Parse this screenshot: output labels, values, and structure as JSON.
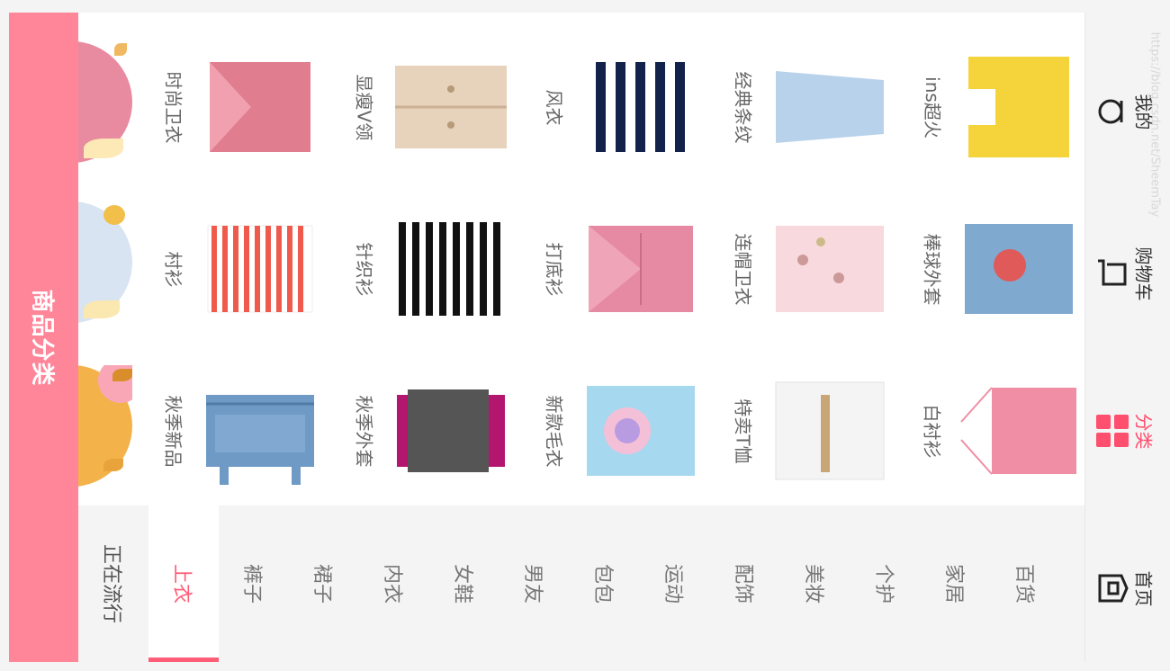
{
  "header": {
    "title": "商品分类"
  },
  "products": [
    {
      "label": "秋季新品",
      "icon": "denim-coat-icon"
    },
    {
      "label": "村衫",
      "icon": "striped-top-icon"
    },
    {
      "label": "时尚卫衣",
      "icon": "pink-sweater-icon"
    },
    {
      "label": "秋季外套",
      "icon": "vest-over-shirt-icon"
    },
    {
      "label": "针织衫",
      "icon": "striped-knit-icon"
    },
    {
      "label": "显瘦V领",
      "icon": "trench-coat-icon"
    },
    {
      "label": "新款毛衣",
      "icon": "tshirt-icon"
    },
    {
      "label": "打底衫",
      "icon": "pink-hoodie-icon"
    },
    {
      "label": "风衣",
      "icon": "striped-sweater-icon"
    },
    {
      "label": "特卖T恤",
      "icon": "white-blouse-icon"
    },
    {
      "label": "连帽卫衣",
      "icon": "floral-jacket-icon"
    },
    {
      "label": "经典条纹",
      "icon": "blue-dress-icon"
    },
    {
      "label": "白衬衫",
      "icon": "pink-knit-top-icon"
    },
    {
      "label": "棒球外套",
      "icon": "denim-jacket-icon"
    },
    {
      "label": "ins超火",
      "icon": "yellow-top-icon"
    }
  ],
  "categories": [
    "正在流行",
    "上衣",
    "裤子",
    "裙子",
    "内衣",
    "女鞋",
    "男友",
    "包包",
    "运动",
    "配饰",
    "美妆",
    "个护",
    "家居",
    "百货"
  ],
  "active_category": "上衣",
  "bottom_nav": [
    {
      "label": "首页",
      "icon": "home-icon"
    },
    {
      "label": "分类",
      "icon": "grid-icon"
    },
    {
      "label": "购物车",
      "icon": "cart-icon"
    },
    {
      "label": "我的",
      "icon": "user-icon"
    }
  ],
  "active_nav": "分类",
  "watermark": "https://blog.csdn.net/SheemTay",
  "colors": {
    "brand": "#ff8599",
    "accent": "#ff4f6e"
  }
}
